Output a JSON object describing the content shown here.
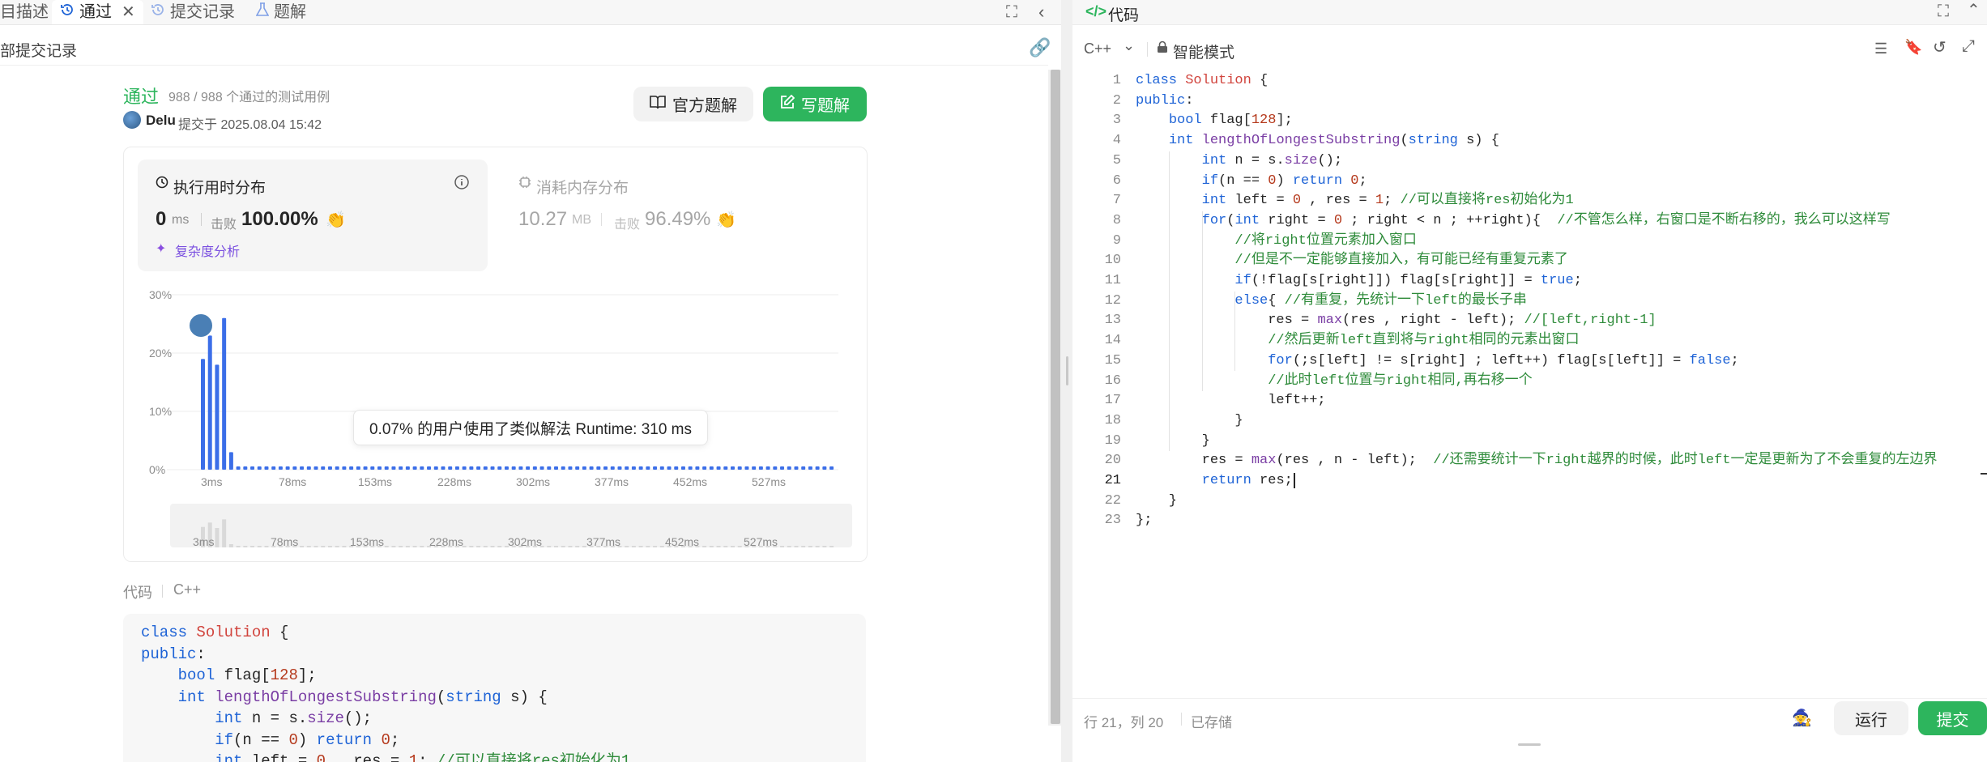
{
  "tabs": [
    {
      "label": "目描述"
    },
    {
      "label": "通过"
    },
    {
      "label": "提交记录"
    },
    {
      "label": "题解"
    }
  ],
  "subbar": {
    "back_label": "部提交记录"
  },
  "result": {
    "status": "通过",
    "cases": "988 / 988 个通过的测试用例",
    "user": "Delu",
    "submitted": "提交于 2025.08.04 15:42",
    "official_solution": "官方题解",
    "write_solution": "写题解"
  },
  "runtime": {
    "title": "执行用时分布",
    "value": "0",
    "unit": "ms",
    "beat_label": "击败",
    "beat": "100.00%",
    "complexity": "复杂度分析"
  },
  "memory": {
    "title": "消耗内存分布",
    "value": "10.27",
    "unit": "MB",
    "beat_label": "击败",
    "beat": "96.49%"
  },
  "chart_data": {
    "type": "bar",
    "y_ticks": [
      "30%",
      "20%",
      "10%",
      "0%"
    ],
    "ylim": [
      0,
      30
    ],
    "x_ticks": [
      "3ms",
      "78ms",
      "153ms",
      "228ms",
      "302ms",
      "377ms",
      "452ms",
      "527ms"
    ],
    "values": [
      19,
      23,
      18,
      26,
      3,
      0.5,
      0.5,
      0.5,
      0.5,
      0.5,
      0.5,
      0.5,
      0.5,
      0.5,
      0.5,
      0.5,
      0.5,
      0.5,
      0.5,
      0.5,
      0.5,
      0.5,
      0.5,
      0.5,
      0.5,
      0.5,
      0.5,
      0.5,
      0.5,
      0.5,
      0.5,
      0.5,
      0.5,
      0.5,
      0.5,
      0.5,
      0.5,
      0.5,
      0.5,
      0.5,
      0.5,
      0.5,
      0.5,
      0.5,
      0.5,
      0.5,
      0.5,
      0.5,
      0.5,
      0.5,
      0.5,
      0.5,
      0.5,
      0.5,
      0.5,
      0.5,
      0.5,
      0.5,
      0.5,
      0.5,
      0.5,
      0.5,
      0.5,
      0.5,
      0.5,
      0.5,
      0.5,
      0.5,
      0.5,
      0.5,
      0.5,
      0.5,
      0.5,
      0.5,
      0.5,
      0.5,
      0.5,
      0.5,
      0.5,
      0.5,
      0.5,
      0.5,
      0.5,
      0.5,
      0.5,
      0.5,
      0.5,
      0.5,
      0.5,
      0.5
    ],
    "bar_color": "#3b6ee8",
    "tooltip": "0.07% 的用户使用了类似解法 Runtime: 310 ms"
  },
  "code_section": {
    "label": "代码",
    "lang": "C++"
  },
  "left_code": [
    "class Solution {",
    "public:",
    "    bool flag[128];",
    "    int lengthOfLongestSubstring(string s) {",
    "        int n = s.size();",
    "        if(n == 0) return 0;",
    "        int left = 0 , res = 1; //可以直接将res初始化为1"
  ],
  "editor": {
    "title": "代码",
    "lang": "C++",
    "mode": "智能模式",
    "lines": [
      "class Solution {",
      "public:",
      "    bool flag[128];",
      "    int lengthOfLongestSubstring(string s) {",
      "        int n = s.size();",
      "        if(n == 0) return 0;",
      "        int left = 0 , res = 1; //可以直接将res初始化为1",
      "        for(int right = 0 ; right < n ; ++right){  //不管怎么样，右窗口是不断右移的，我么可以这样写",
      "            //将right位置元素加入窗口",
      "            //但是不一定能够直接加入，有可能已经有重复元素了",
      "            if(!flag[s[right]]) flag[s[right]] = true;",
      "            else{ //有重复，先统计一下left的最长子串",
      "                res = max(res , right - left); //[left,right-1]",
      "                //然后更新left直到将与right相同的元素出窗口",
      "                for(;s[left] != s[right] ; left++) flag[s[left]] = false;",
      "                //此时left位置与right相同,再右移一个",
      "                left++;",
      "            }",
      "        }",
      "        res = max(res , n - left);  //还需要统计一下right越界的时候，此时left一定是更新为了不会重复的左边界",
      "        return res;",
      "    }",
      "};"
    ],
    "cursor": "行 21，列 20",
    "saved": "已存储",
    "run": "运行",
    "submit": "提交"
  },
  "colors": {
    "accent": "#2db55d",
    "primary_bar": "#3b6ee8"
  }
}
